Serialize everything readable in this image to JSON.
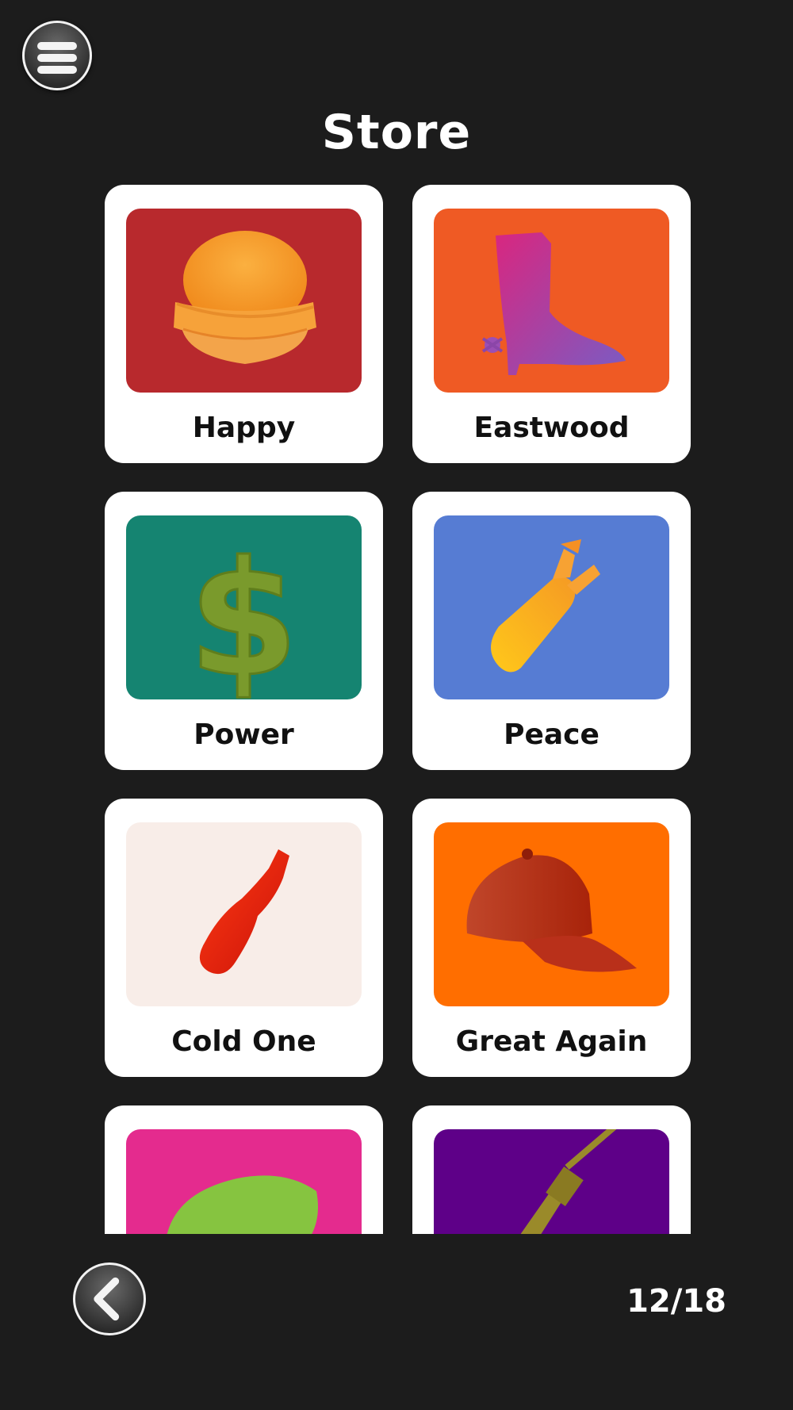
{
  "header": {
    "title": "Store"
  },
  "items": [
    {
      "label": "Happy",
      "icon": "burger-icon",
      "bg": "#b8292d"
    },
    {
      "label": "Eastwood",
      "icon": "cowboy-boot-icon",
      "bg": "#ef5a24"
    },
    {
      "label": "Power",
      "icon": "dollar-sign-icon",
      "bg": "#158471"
    },
    {
      "label": "Peace",
      "icon": "bomb-icon",
      "bg": "#567cd3"
    },
    {
      "label": "Cold One",
      "icon": "soda-bottle-icon",
      "bg": "#f8ede8"
    },
    {
      "label": "Great Again",
      "icon": "baseball-cap-icon",
      "bg": "#ff6e00"
    },
    {
      "label": "",
      "icon": "green-blob-icon",
      "bg": "#e42b8e"
    },
    {
      "label": "",
      "icon": "rifle-icon",
      "bg": "#5e0088"
    }
  ],
  "footer": {
    "page_indicator": "12/18"
  }
}
